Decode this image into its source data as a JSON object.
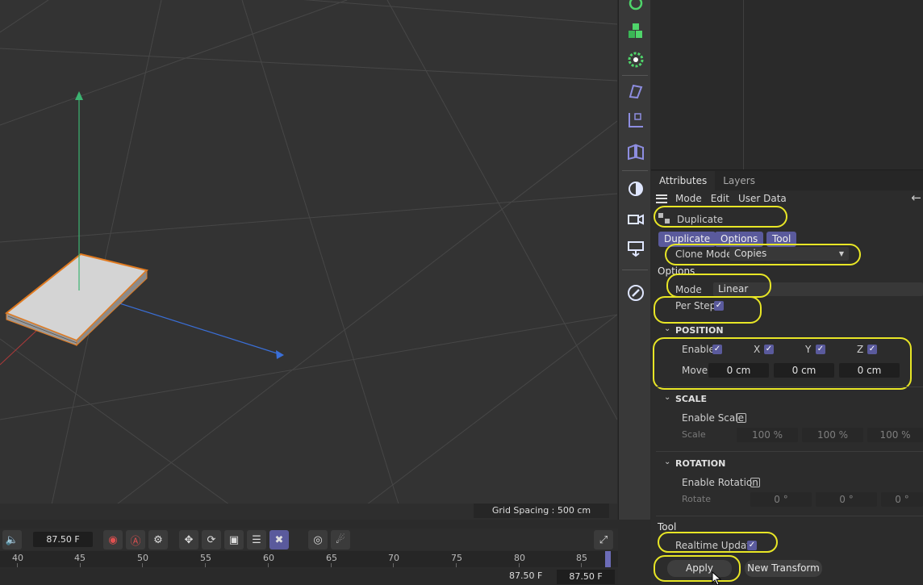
{
  "viewport": {
    "grid_label": "Grid Spacing : 500 cm"
  },
  "toolbar_icons": [
    "cloner-icon",
    "cubes-icon",
    "gear-icon",
    "deformer-icon",
    "axis-icon",
    "mirror-icon",
    "light-icon",
    "camera-icon",
    "render-icon",
    "edit-icon"
  ],
  "attributes": {
    "tabs": [
      "Attributes",
      "Layers"
    ],
    "menu": [
      "Mode",
      "Edit",
      "User Data"
    ],
    "object_name": "Duplicate",
    "subtabs": [
      "Duplicate",
      "Options",
      "Tool"
    ],
    "clone_mode_label": "Clone Mode",
    "clone_mode_value": "Copies",
    "options_header": "Options",
    "mode_label": "Mode",
    "mode_value": "Linear",
    "per_step_label": "Per Step",
    "per_step_checked": true,
    "position": {
      "title": "POSITION",
      "enable_label": "Enable",
      "x_label": "X",
      "y_label": "Y",
      "z_label": "Z",
      "move_label": "Move",
      "move_x": "0 cm",
      "move_y": "0 cm",
      "move_z": "0 cm"
    },
    "scale": {
      "title": "SCALE",
      "enable_label": "Enable Scale",
      "scale_label": "Scale",
      "values": [
        "100 %",
        "100 %",
        "100 %"
      ]
    },
    "rotation": {
      "title": "ROTATION",
      "enable_label": "Enable Rotation",
      "rotate_label": "Rotate",
      "values": [
        "0 °",
        "0 °",
        "0 °"
      ]
    },
    "tool_header": "Tool",
    "realtime_label": "Realtime Update",
    "realtime_checked": true,
    "apply_label": "Apply",
    "new_transform_label": "New Transform"
  },
  "timeline": {
    "current_frame": "87.50 F",
    "ruler": [
      "40",
      "45",
      "50",
      "55",
      "60",
      "65",
      "70",
      "75",
      "80",
      "85"
    ],
    "bottom_value": "87.50 F",
    "bottom_field": "87.50 F"
  },
  "colors": {
    "accent": "#5a5a9c",
    "highlight": "#e8e626",
    "viewport_bg": "#333333",
    "object_outline": "#e07a20",
    "y_axis": "#3cb371",
    "z_axis": "#3a6fd8"
  }
}
